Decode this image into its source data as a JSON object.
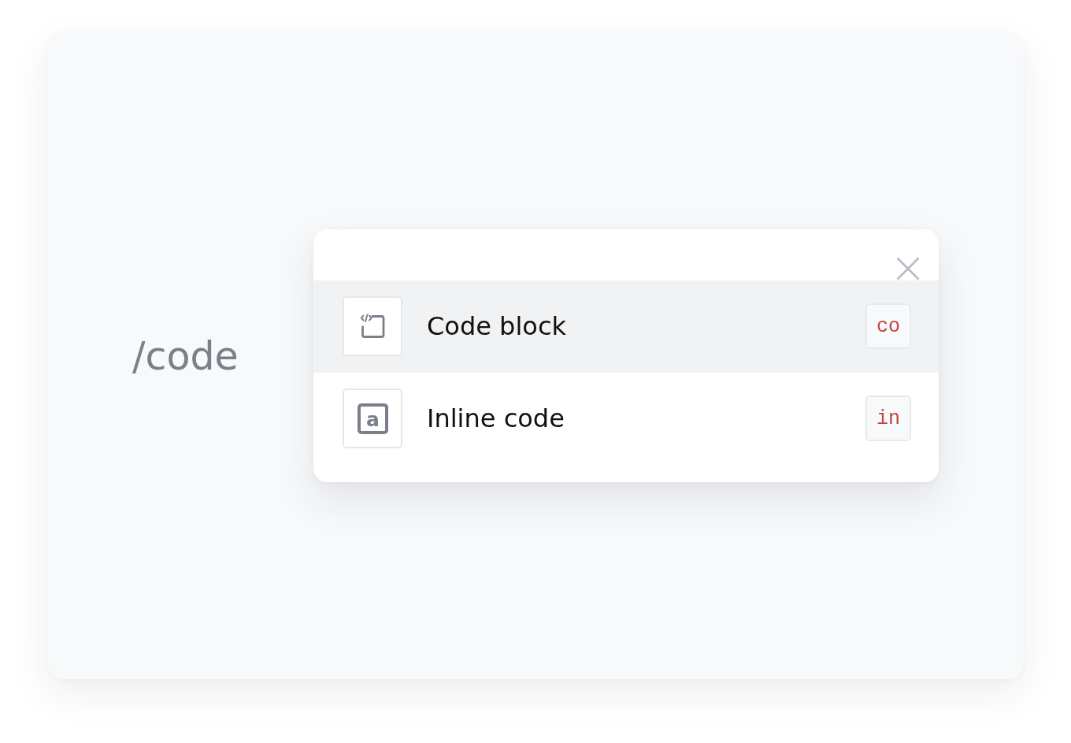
{
  "command": {
    "text": "/code"
  },
  "menu": {
    "items": [
      {
        "kind": "code_block",
        "label": "Code block",
        "shortcut": "co",
        "selected": true
      },
      {
        "kind": "inline_code",
        "label": "Inline code",
        "shortcut": "in",
        "selected": false,
        "icon_letter": "a"
      }
    ]
  }
}
